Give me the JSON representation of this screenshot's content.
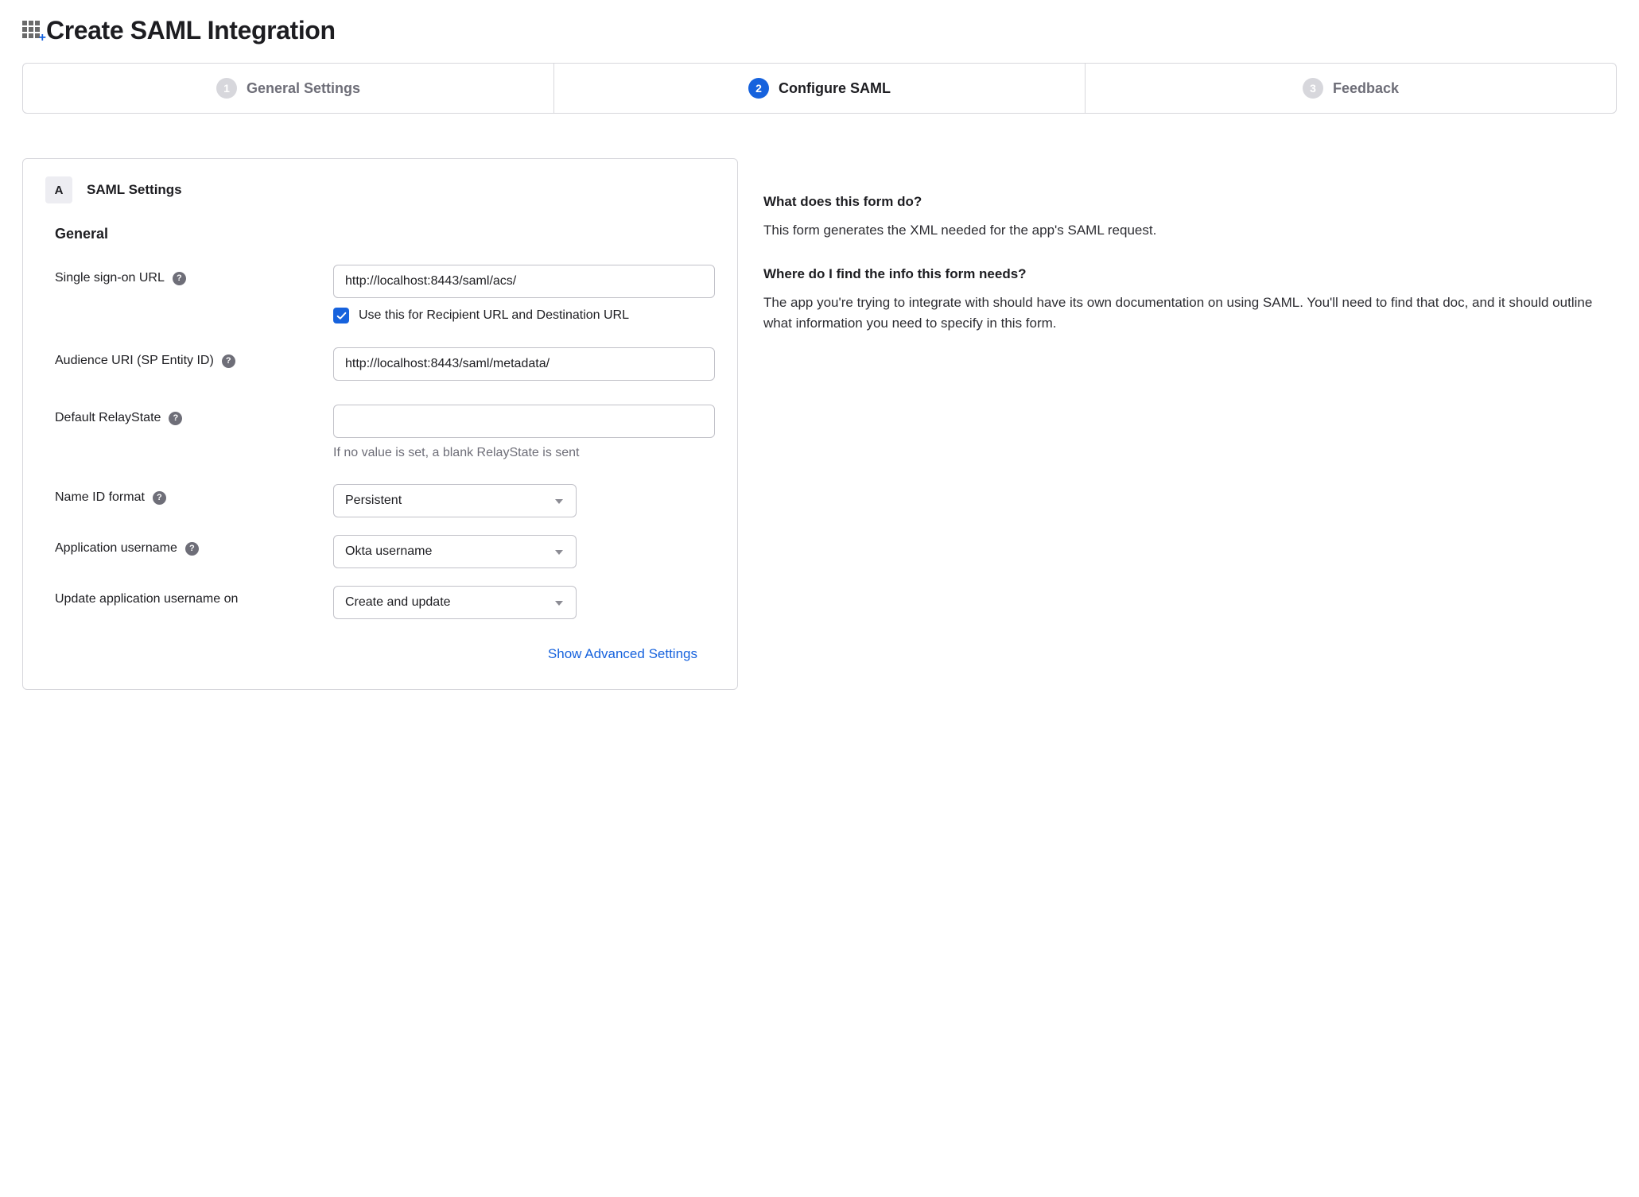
{
  "page": {
    "title": "Create SAML Integration"
  },
  "steps": [
    {
      "num": "1",
      "label": "General Settings",
      "state": "inactive"
    },
    {
      "num": "2",
      "label": "Configure SAML",
      "state": "active"
    },
    {
      "num": "3",
      "label": "Feedback",
      "state": "inactive"
    }
  ],
  "section": {
    "letter": "A",
    "title": "SAML Settings",
    "subheading": "General"
  },
  "fields": {
    "sso_url": {
      "label": "Single sign-on URL",
      "value": "http://localhost:8443/saml/acs/",
      "checkbox_label": "Use this for Recipient URL and Destination URL",
      "checkbox_checked": true
    },
    "audience_uri": {
      "label": "Audience URI (SP Entity ID)",
      "value": "http://localhost:8443/saml/metadata/"
    },
    "relay_state": {
      "label": "Default RelayState",
      "value": "",
      "hint": "If no value is set, a blank RelayState is sent"
    },
    "name_id_format": {
      "label": "Name ID format",
      "value": "Persistent"
    },
    "app_username": {
      "label": "Application username",
      "value": "Okta username"
    },
    "update_username_on": {
      "label": "Update application username on",
      "value": "Create and update"
    }
  },
  "advanced_link": "Show Advanced Settings",
  "sidebar": {
    "q1_title": "What does this form do?",
    "q1_body": "This form generates the XML needed for the app's SAML request.",
    "q2_title": "Where do I find the info this form needs?",
    "q2_body": "The app you're trying to integrate with should have its own documentation on using SAML. You'll need to find that doc, and it should outline what information you need to specify in this form."
  }
}
